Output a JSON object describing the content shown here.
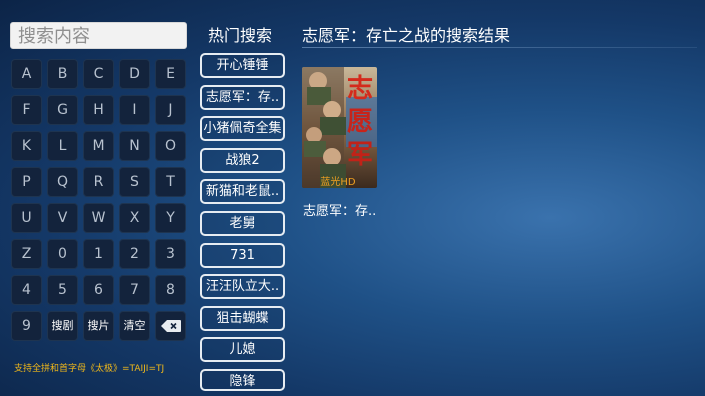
{
  "search": {
    "placeholder": "搜索内容"
  },
  "keyboard": {
    "rows": [
      [
        "A",
        "B",
        "C",
        "D",
        "E"
      ],
      [
        "F",
        "G",
        "H",
        "I",
        "J"
      ],
      [
        "K",
        "L",
        "M",
        "N",
        "O"
      ],
      [
        "P",
        "Q",
        "R",
        "S",
        "T"
      ],
      [
        "U",
        "V",
        "W",
        "X",
        "Y"
      ],
      [
        "Z",
        "0",
        "1",
        "2",
        "3"
      ],
      [
        "4",
        "5",
        "6",
        "7",
        "8"
      ]
    ],
    "last_row": {
      "nine": "9",
      "search_drama": "搜剧",
      "search_movie": "搜片",
      "clear": "清空"
    }
  },
  "hint": "支持全拼和首字母《太极》=TAIJI=TJ",
  "hot": {
    "title": "热门搜索",
    "items": [
      "开心锤锤",
      "志愿军：存..",
      "小猪佩奇全集",
      "战狼2",
      "新猫和老鼠..",
      "老舅",
      "731",
      "汪汪队立大..",
      "狙击蝴蝶",
      "儿媳",
      "隐锋"
    ]
  },
  "results": {
    "title": "志愿军：存亡之战的搜索结果",
    "items": [
      {
        "name": "志愿军：存..",
        "poster_text": "志愿军",
        "badge": "蓝光HD"
      }
    ]
  },
  "colors": {
    "hint": "#f0b81a",
    "badge": "#f0a020"
  }
}
